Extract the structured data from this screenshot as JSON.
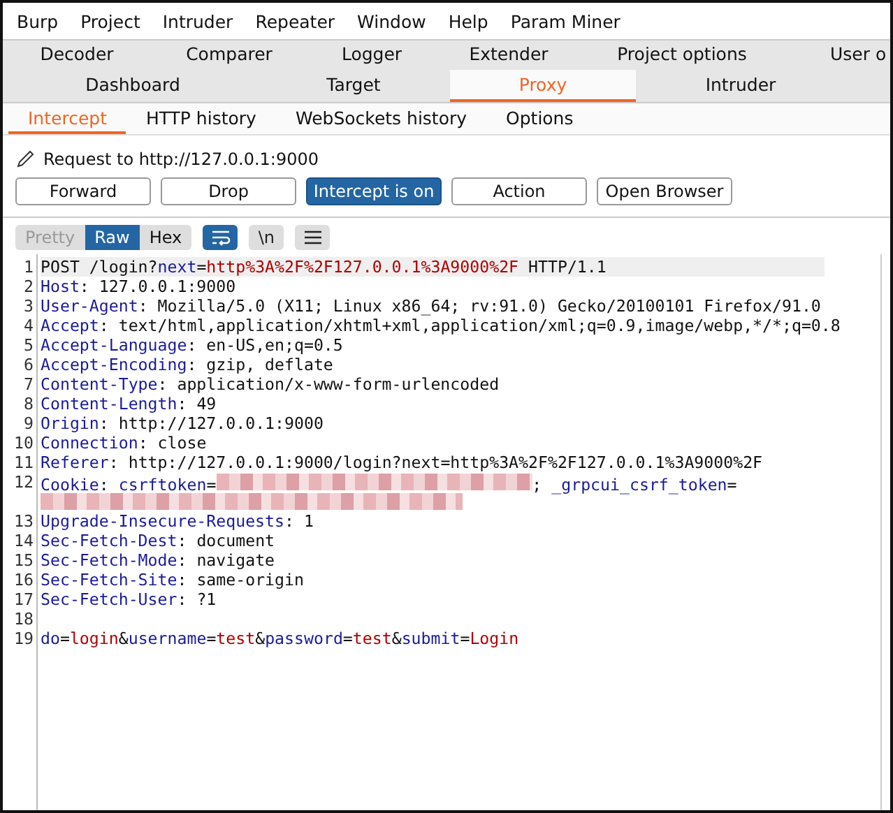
{
  "menu": [
    "Burp",
    "Project",
    "Intruder",
    "Repeater",
    "Window",
    "Help",
    "Param Miner"
  ],
  "tool_tabs": [
    [
      {
        "label": "Decoder",
        "selected": false
      },
      {
        "label": "Comparer",
        "selected": false
      },
      {
        "label": "Logger",
        "selected": false
      },
      {
        "label": "Extender",
        "selected": false
      },
      {
        "label": "Project options",
        "selected": false
      },
      {
        "label": "User o",
        "selected": false
      }
    ],
    [
      {
        "label": "Dashboard",
        "selected": false
      },
      {
        "label": "Target",
        "selected": false
      },
      {
        "label": "Proxy",
        "selected": true
      },
      {
        "label": "Intruder",
        "selected": false
      }
    ]
  ],
  "proxy_tabs": [
    {
      "label": "Intercept",
      "selected": true
    },
    {
      "label": "HTTP history",
      "selected": false
    },
    {
      "label": "WebSockets history",
      "selected": false
    },
    {
      "label": "Options",
      "selected": false
    }
  ],
  "request_label": "Request to http://127.0.0.1:9000",
  "buttons": [
    {
      "label": "Forward",
      "selected": false
    },
    {
      "label": "Drop",
      "selected": false
    },
    {
      "label": "Intercept is on",
      "selected": true
    },
    {
      "label": "Action",
      "selected": false
    },
    {
      "label": "Open Browser",
      "selected": false
    }
  ],
  "view_tabs": [
    {
      "label": "Pretty",
      "selected": false,
      "disabled": true
    },
    {
      "label": "Raw",
      "selected": true,
      "disabled": false
    },
    {
      "label": "Hex",
      "selected": false,
      "disabled": false
    }
  ],
  "view_toggles": [
    {
      "kind": "wrap",
      "on": true
    },
    {
      "kind": "text",
      "label": "\\n",
      "on": false
    },
    {
      "kind": "menu",
      "on": false
    }
  ],
  "editor": {
    "lines": [
      {
        "number": "1",
        "highlighted": true,
        "segments": [
          {
            "kind": "plain",
            "text": "POST /login?"
          },
          {
            "kind": "key",
            "text": "next"
          },
          {
            "kind": "plain",
            "text": "="
          },
          {
            "kind": "value",
            "text": "http%3A%2F%2F127.0.0.1%3A9000%2F"
          },
          {
            "kind": "plain",
            "text": " HTTP/1.1"
          }
        ]
      },
      {
        "number": "2",
        "highlighted": false,
        "segments": [
          {
            "kind": "key",
            "text": "Host"
          },
          {
            "kind": "plain",
            "text": ": 127.0.0.1:9000"
          }
        ]
      },
      {
        "number": "3",
        "highlighted": false,
        "segments": [
          {
            "kind": "key",
            "text": "User-Agent"
          },
          {
            "kind": "plain",
            "text": ": Mozilla/5.0 (X11; Linux x86_64; rv:91.0) Gecko/20100101 Firefox/91.0"
          }
        ]
      },
      {
        "number": "4",
        "highlighted": false,
        "segments": [
          {
            "kind": "key",
            "text": "Accept"
          },
          {
            "kind": "plain",
            "text": ": text/html,application/xhtml+xml,application/xml;q=0.9,image/webp,*/*;q=0.8"
          }
        ]
      },
      {
        "number": "5",
        "highlighted": false,
        "segments": [
          {
            "kind": "key",
            "text": "Accept-Language"
          },
          {
            "kind": "plain",
            "text": ": en-US,en;q=0.5"
          }
        ]
      },
      {
        "number": "6",
        "highlighted": false,
        "segments": [
          {
            "kind": "key",
            "text": "Accept-Encoding"
          },
          {
            "kind": "plain",
            "text": ": gzip, deflate"
          }
        ]
      },
      {
        "number": "7",
        "highlighted": false,
        "segments": [
          {
            "kind": "key",
            "text": "Content-Type"
          },
          {
            "kind": "plain",
            "text": ": application/x-www-form-urlencoded"
          }
        ]
      },
      {
        "number": "8",
        "highlighted": false,
        "segments": [
          {
            "kind": "key",
            "text": "Content-Length"
          },
          {
            "kind": "plain",
            "text": ": 49"
          }
        ]
      },
      {
        "number": "9",
        "highlighted": false,
        "segments": [
          {
            "kind": "key",
            "text": "Origin"
          },
          {
            "kind": "plain",
            "text": ": http://127.0.0.1:9000"
          }
        ]
      },
      {
        "number": "10",
        "highlighted": false,
        "segments": [
          {
            "kind": "key",
            "text": "Connection"
          },
          {
            "kind": "plain",
            "text": ": close"
          }
        ]
      },
      {
        "number": "11",
        "highlighted": false,
        "segments": [
          {
            "kind": "key",
            "text": "Referer"
          },
          {
            "kind": "plain",
            "text": ": http://127.0.0.1:9000/login?next=http%3A%2F%2F127.0.0.1%3A9000%2F"
          }
        ]
      },
      {
        "number": "12",
        "highlighted": false,
        "segments": [
          {
            "kind": "key",
            "text": "Cookie"
          },
          {
            "kind": "plain",
            "text": ": "
          },
          {
            "kind": "key",
            "text": "csrftoken"
          },
          {
            "kind": "plain",
            "text": "="
          },
          {
            "kind": "redacted"
          },
          {
            "kind": "plain",
            "text": "; "
          },
          {
            "kind": "key",
            "text": "_grpcui_csrf_token"
          },
          {
            "kind": "plain",
            "text": "="
          }
        ]
      },
      {
        "highlighted": false,
        "segments": [
          {
            "kind": "redacted"
          }
        ]
      },
      {
        "number": "13",
        "highlighted": false,
        "segments": [
          {
            "kind": "key",
            "text": "Upgrade-Insecure-Requests"
          },
          {
            "kind": "plain",
            "text": ": 1"
          }
        ]
      },
      {
        "number": "14",
        "highlighted": false,
        "segments": [
          {
            "kind": "key",
            "text": "Sec-Fetch-Dest"
          },
          {
            "kind": "plain",
            "text": ": document"
          }
        ]
      },
      {
        "number": "15",
        "highlighted": false,
        "segments": [
          {
            "kind": "key",
            "text": "Sec-Fetch-Mode"
          },
          {
            "kind": "plain",
            "text": ": navigate"
          }
        ]
      },
      {
        "number": "16",
        "highlighted": false,
        "segments": [
          {
            "kind": "key",
            "text": "Sec-Fetch-Site"
          },
          {
            "kind": "plain",
            "text": ": same-origin"
          }
        ]
      },
      {
        "number": "17",
        "highlighted": false,
        "segments": [
          {
            "kind": "key",
            "text": "Sec-Fetch-User"
          },
          {
            "kind": "plain",
            "text": ": ?1"
          }
        ]
      },
      {
        "number": "18",
        "highlighted": false
      },
      {
        "number": "19",
        "highlighted": false,
        "segments": [
          {
            "kind": "key",
            "text": "do"
          },
          {
            "kind": "plain",
            "text": "="
          },
          {
            "kind": "value",
            "text": "login"
          },
          {
            "kind": "plain",
            "text": "&"
          },
          {
            "kind": "key",
            "text": "username"
          },
          {
            "kind": "plain",
            "text": "="
          },
          {
            "kind": "value",
            "text": "test"
          },
          {
            "kind": "plain",
            "text": "&"
          },
          {
            "kind": "key",
            "text": "password"
          },
          {
            "kind": "plain",
            "text": "="
          },
          {
            "kind": "value",
            "text": "test"
          },
          {
            "kind": "plain",
            "text": "&"
          },
          {
            "kind": "key",
            "text": "submit"
          },
          {
            "kind": "plain",
            "text": "="
          },
          {
            "kind": "value",
            "text": "Login"
          }
        ]
      }
    ]
  }
}
